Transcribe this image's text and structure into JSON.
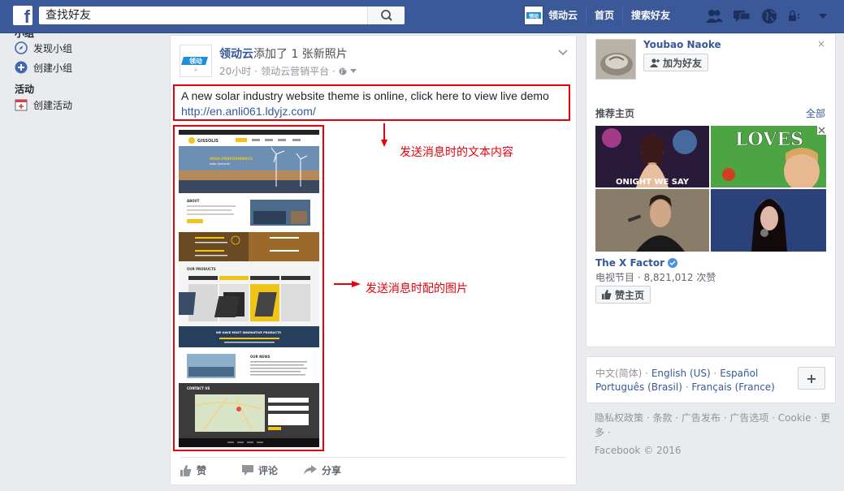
{
  "topbar": {
    "logo": "f",
    "search_placeholder": "查找好友",
    "user_name": "领动云",
    "home": "首页",
    "find_friends": "搜索好友",
    "brand_color": "#3b5998"
  },
  "left_nav": {
    "group_section_partial": "小组",
    "discover_groups": "发现小组",
    "create_group": "创建小组",
    "events_heading": "活动",
    "create_event": "创建活动"
  },
  "post": {
    "author": "领动云",
    "action": "添加了 1 张新照片",
    "time": "20小时",
    "source": "领动云营销平台",
    "text": "A new solar industry website theme is online, click here to view live demo",
    "link": "http://en.anli061.ldyjz.com/",
    "annotation_text": "发送消息时的文本内容",
    "annotation_image": "发送消息时配的图片",
    "actions": {
      "like": "赞",
      "comment": "评论",
      "share": "分享"
    },
    "site": {
      "logo": "GISSOLIS",
      "hero": "HIGH-PERFORMANCE",
      "hero_sub": "solar products",
      "about": "ABOUT",
      "products": "OUR PRODUCTS",
      "news": "OUR NEWS",
      "contact": "CONTACT US",
      "banner": "WE HAVE MOST INNOVATIVE PRODUCTS"
    }
  },
  "right": {
    "pymk_name": "Youbao Naoke",
    "pymk_add": "加为好友",
    "close": "×",
    "rec_title": "推荐主页",
    "rec_all": "全部",
    "tile_loves": "LOVES",
    "tile_caption": "ONIGHT WE SAY",
    "page_name": "The X Factor",
    "page_meta": "电视节目 · 8,821,012 次赞",
    "page_like": "赞主页",
    "languages_prefix": "中文(简体) · ",
    "lang_en": "English (US)",
    "lang_es": "Español",
    "lang_pt": "Português (Brasil)",
    "lang_fr": "Français (France)",
    "sep": " · ",
    "plus": "+",
    "footer": "隐私权政策 · 条款 · 广告发布 · 广告选项 · Cookie · 更多 ·",
    "copyright": "Facebook © 2016"
  }
}
